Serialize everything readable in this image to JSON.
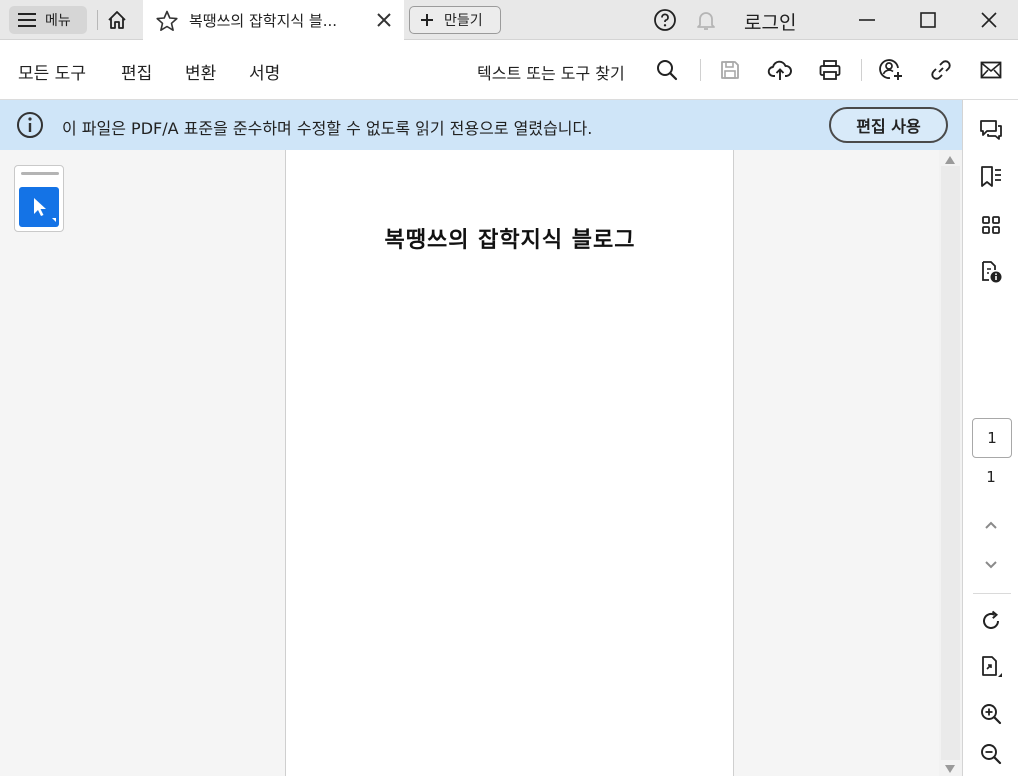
{
  "titlebar": {
    "menu_label": "메뉴",
    "tab_title": "복땡쓰의 잡학지식 블...",
    "create_label": "만들기",
    "login_label": "로그인",
    "icons": [
      "hamburger-icon",
      "home-icon",
      "star-icon",
      "close-icon",
      "plus-icon",
      "help-icon",
      "bell-icon",
      "minimize-icon",
      "maximize-icon",
      "window-close-icon"
    ]
  },
  "toolbar": {
    "menus": [
      "모든 도구",
      "편집",
      "변환",
      "서명"
    ],
    "find_label": "텍스트 또는 도구 찾기",
    "icons": [
      "search-icon",
      "save-icon",
      "upload-cloud-icon",
      "print-icon",
      "share-user-icon",
      "link-icon",
      "mail-icon"
    ]
  },
  "banner": {
    "message": "이 파일은 PDF/A 표준을 준수하며 수정할 수 없도록 읽기 전용으로 열렸습니다.",
    "button_label": "편집 사용",
    "color": "#cfe5f8"
  },
  "left_panel": {
    "tool_icon": "select-arrow-icon",
    "accent": "#1473e6"
  },
  "document": {
    "heading": "복땡쓰의 잡학지식 블로그"
  },
  "right_rail": {
    "current_page": "1",
    "total_pages": "1",
    "icons": [
      "comments-icon",
      "bookmarks-icon",
      "thumbnails-icon",
      "file-info-icon",
      "page-up-icon",
      "page-down-icon",
      "rotate-icon",
      "extract-page-icon",
      "zoom-in-icon",
      "zoom-out-icon"
    ]
  }
}
